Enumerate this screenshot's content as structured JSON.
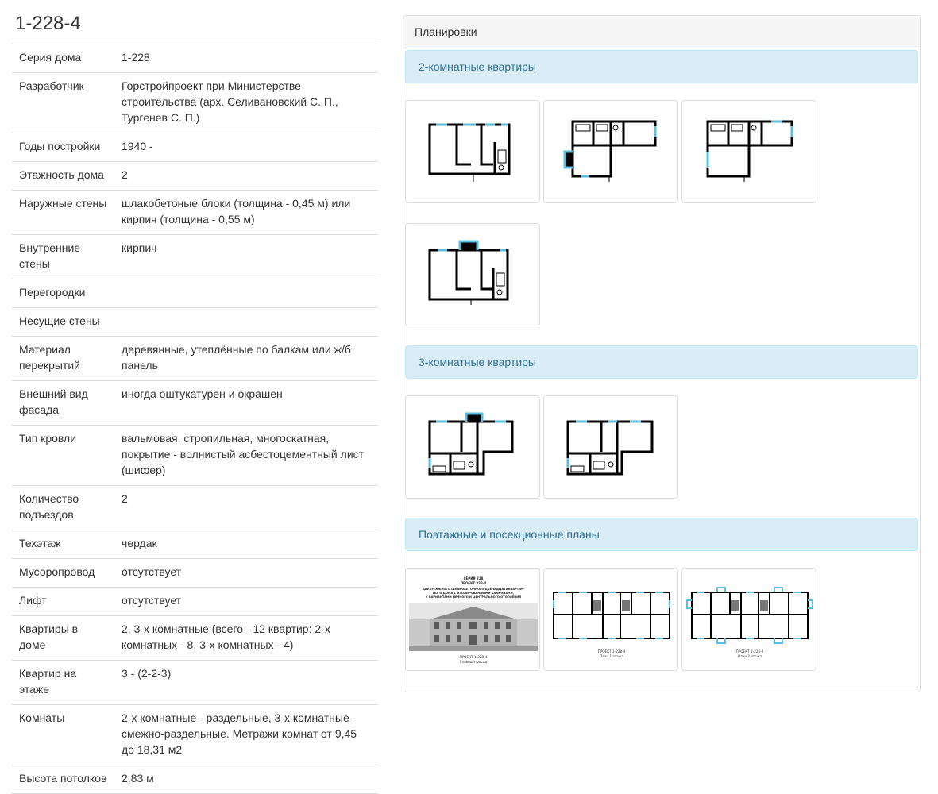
{
  "page": {
    "title": "1-228-4"
  },
  "specs": [
    {
      "label": "Серия дома",
      "value": "1-228"
    },
    {
      "label": "Разработчик",
      "value": "Горстройпроект при Министерстве строительства (арх. Селивановский С. П., Тургенев С. П.)"
    },
    {
      "label": "Годы постройки",
      "value": "1940 -"
    },
    {
      "label": "Этажность дома",
      "value": "2"
    },
    {
      "label": "Наружные стены",
      "value": "шлакобетоные блоки (толщина - 0,45 м) или кирпич (толщина - 0,55 м)"
    },
    {
      "label": "Внутренние стены",
      "value": "кирпич"
    },
    {
      "label": "Перегородки",
      "value": ""
    },
    {
      "label": "Несущие стены",
      "value": ""
    },
    {
      "label": "Материал перекрытий",
      "value": "деревянные, утеплённые по балкам или ж/б панель"
    },
    {
      "label": "Внешний вид фасада",
      "value": "иногда оштукатурен и окрашен"
    },
    {
      "label": "Тип кровли",
      "value": "вальмовая, стропильная, многоскатная, покрытие - волнистый асбестоцементный лист (шифер)"
    },
    {
      "label": "Количество подъездов",
      "value": "2"
    },
    {
      "label": "Техэтаж",
      "value": "чердак"
    },
    {
      "label": "Мусоропровод",
      "value": "отсутствует"
    },
    {
      "label": "Лифт",
      "value": "отсутствует"
    },
    {
      "label": "Квартиры в доме",
      "value": "2, 3-х комнатные (всего - 12 квартир: 2-х комнатных - 8, 3-х комнатных - 4)"
    },
    {
      "label": "Квартир на этаже",
      "value": "3 - (2-2-3)"
    },
    {
      "label": "Комнаты",
      "value": "2-х комнатные - раздельные, 3-х комнатные - смежно-раздельные. Метражи комнат от 9,45 до 18,31 м2"
    },
    {
      "label": "Высота потолков",
      "value": "2,83 м"
    }
  ],
  "layouts_panel": {
    "heading": "Планировки",
    "sections": [
      {
        "title": "2-комнатные квартиры",
        "thumbs": [
          "plan-2room-a",
          "plan-2room-b",
          "plan-2room-c",
          "plan-2room-d"
        ]
      },
      {
        "title": "3-комнатные квартиры",
        "thumbs": [
          "plan-3room-a",
          "plan-3room-b"
        ]
      },
      {
        "title": "Поэтажные и посекционные планы",
        "thumbs": [
          "facade-sheet",
          "floor-plan-1",
          "floor-plan-2"
        ]
      }
    ],
    "facade_sheet": {
      "header_lines": [
        "СЕРИЯ 228",
        "ПРОЕКТ 228-4",
        "ДВУХЭТАЖНОГО ШЛАКОБЕТОННОГО ДВЕНАДЦАТИКВАРТИР-",
        "НОГО ДОМА С ИЗОЛИРОВАННЫМИ БАЛКОНАМИ,",
        "С ВАРИАНТАМИ ПЕЧНОГО И ЦЕНТРАЛЬНОГО ОТОПЛЕНИЯ"
      ],
      "caption_lines": [
        "ПРОЕКТ 1-228-4",
        "Главный фасад"
      ]
    },
    "floor_plan_1": {
      "caption_lines": [
        "ПРОЕКТ 1-228-4",
        "План 1 этажа"
      ]
    },
    "floor_plan_2": {
      "caption_lines": [
        "ПРОЕКТ 1-228-4",
        "План 2 этажа"
      ]
    }
  },
  "colors": {
    "section_bg": "#d9edf7",
    "section_text": "#31708f",
    "window": "#5bc0de",
    "wall": "#000000"
  }
}
